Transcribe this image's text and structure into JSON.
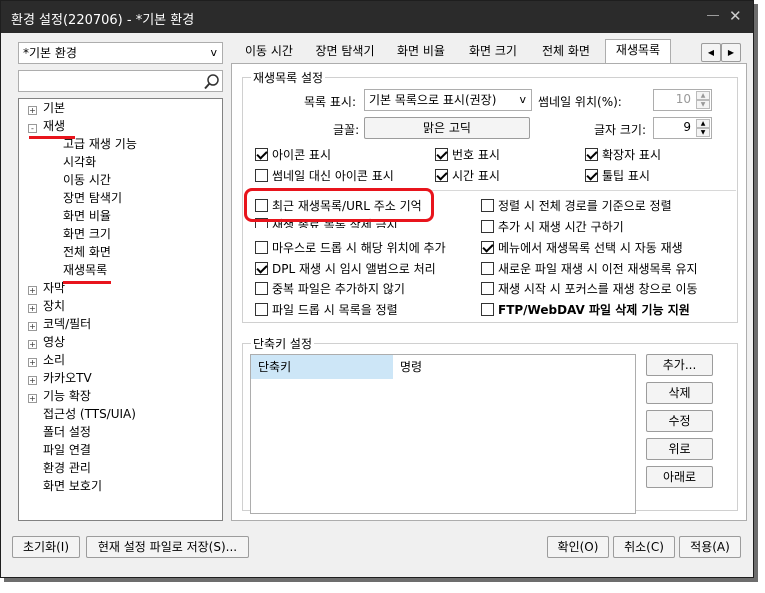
{
  "window": {
    "title": "환경 설정(220706) - *기본 환경",
    "pin_icon": "pin-icon",
    "close_icon": "close-icon"
  },
  "preset": {
    "value": "*기본 환경"
  },
  "search": {
    "placeholder": ""
  },
  "tree": {
    "items": [
      {
        "label": "기본",
        "expander": "+"
      },
      {
        "label": "재생",
        "expander": "-"
      },
      {
        "label": "고급 재생 기능"
      },
      {
        "label": "시각화"
      },
      {
        "label": "이동 시간"
      },
      {
        "label": "장면 탐색기"
      },
      {
        "label": "화면 비율"
      },
      {
        "label": "화면 크기"
      },
      {
        "label": "전체 화면"
      },
      {
        "label": "재생목록"
      },
      {
        "label": "자막",
        "expander": "+"
      },
      {
        "label": "장치",
        "expander": "+"
      },
      {
        "label": "코덱/필터",
        "expander": "+"
      },
      {
        "label": "영상",
        "expander": "+"
      },
      {
        "label": "소리",
        "expander": "+"
      },
      {
        "label": "카카오TV",
        "expander": "+"
      },
      {
        "label": "기능 확장",
        "expander": "+"
      },
      {
        "label": "접근성 (TTS/UIA)"
      },
      {
        "label": "폴더 설정"
      },
      {
        "label": "파일 연결"
      },
      {
        "label": "환경 관리"
      },
      {
        "label": "화면 보호기"
      }
    ]
  },
  "tabs": [
    {
      "label": "이동 시간"
    },
    {
      "label": "장면 탐색기"
    },
    {
      "label": "화면 비율"
    },
    {
      "label": "화면 크기"
    },
    {
      "label": "전체 화면"
    },
    {
      "label": "재생목록",
      "active": true
    }
  ],
  "playlist": {
    "group_title": "재생목록 설정",
    "display_label": "목록 표시:",
    "display_value": "기본 목록으로 표시(권장)",
    "thumb_pos_label": "썸네일 위치(%):",
    "thumb_pos_value": "10",
    "font_label": "글꼴:",
    "font_value": "맑은 고딕",
    "font_size_label": "글자 크기:",
    "font_size_value": "9",
    "checks": [
      {
        "label": "아이콘 표시",
        "checked": true
      },
      {
        "label": "번호 표시",
        "checked": true
      },
      {
        "label": "확장자 표시",
        "checked": true
      },
      {
        "label": "썸네일 대신 아이콘 표시",
        "checked": false
      },
      {
        "label": "시간 표시",
        "checked": true
      },
      {
        "label": "툴팁 표시",
        "checked": true
      },
      {
        "label": "최근 재생목록/URL 주소 기억",
        "checked": false
      },
      {
        "label": "정렬 시 전체 경로를 기준으로 정렬",
        "checked": false
      },
      {
        "label": "재생 종료 목록 삭제 금지",
        "checked": false
      },
      {
        "label": "추가 시 재생 시간 구하기",
        "checked": false
      },
      {
        "label": "마우스로 드롭 시 해당 위치에 추가",
        "checked": false
      },
      {
        "label": "메뉴에서 재생목록 선택 시 자동 재생",
        "checked": true
      },
      {
        "label": "DPL 재생 시 임시 앨범으로 처리",
        "checked": true
      },
      {
        "label": "새로운 파일 재생 시 이전 재생목록 유지",
        "checked": false
      },
      {
        "label": "중복 파일은 추가하지 않기",
        "checked": false
      },
      {
        "label": "재생 시작 시 포커스를 재생 창으로 이동",
        "checked": false
      },
      {
        "label": "파일 드롭 시 목록을 정렬",
        "checked": false
      },
      {
        "label": "FTP/WebDAV 파일 삭제 기능 지원",
        "checked": false
      }
    ]
  },
  "shortcuts": {
    "group_title": "단축키 설정",
    "columns": [
      "단축키",
      "명령"
    ],
    "buttons": [
      "추가...",
      "삭제",
      "수정",
      "위로",
      "아래로"
    ]
  },
  "footer": {
    "reset": "초기화(I)",
    "save_as": "현재 설정 파일로 저장(S)...",
    "ok": "확인(O)",
    "cancel": "취소(C)",
    "apply": "적용(A)"
  }
}
